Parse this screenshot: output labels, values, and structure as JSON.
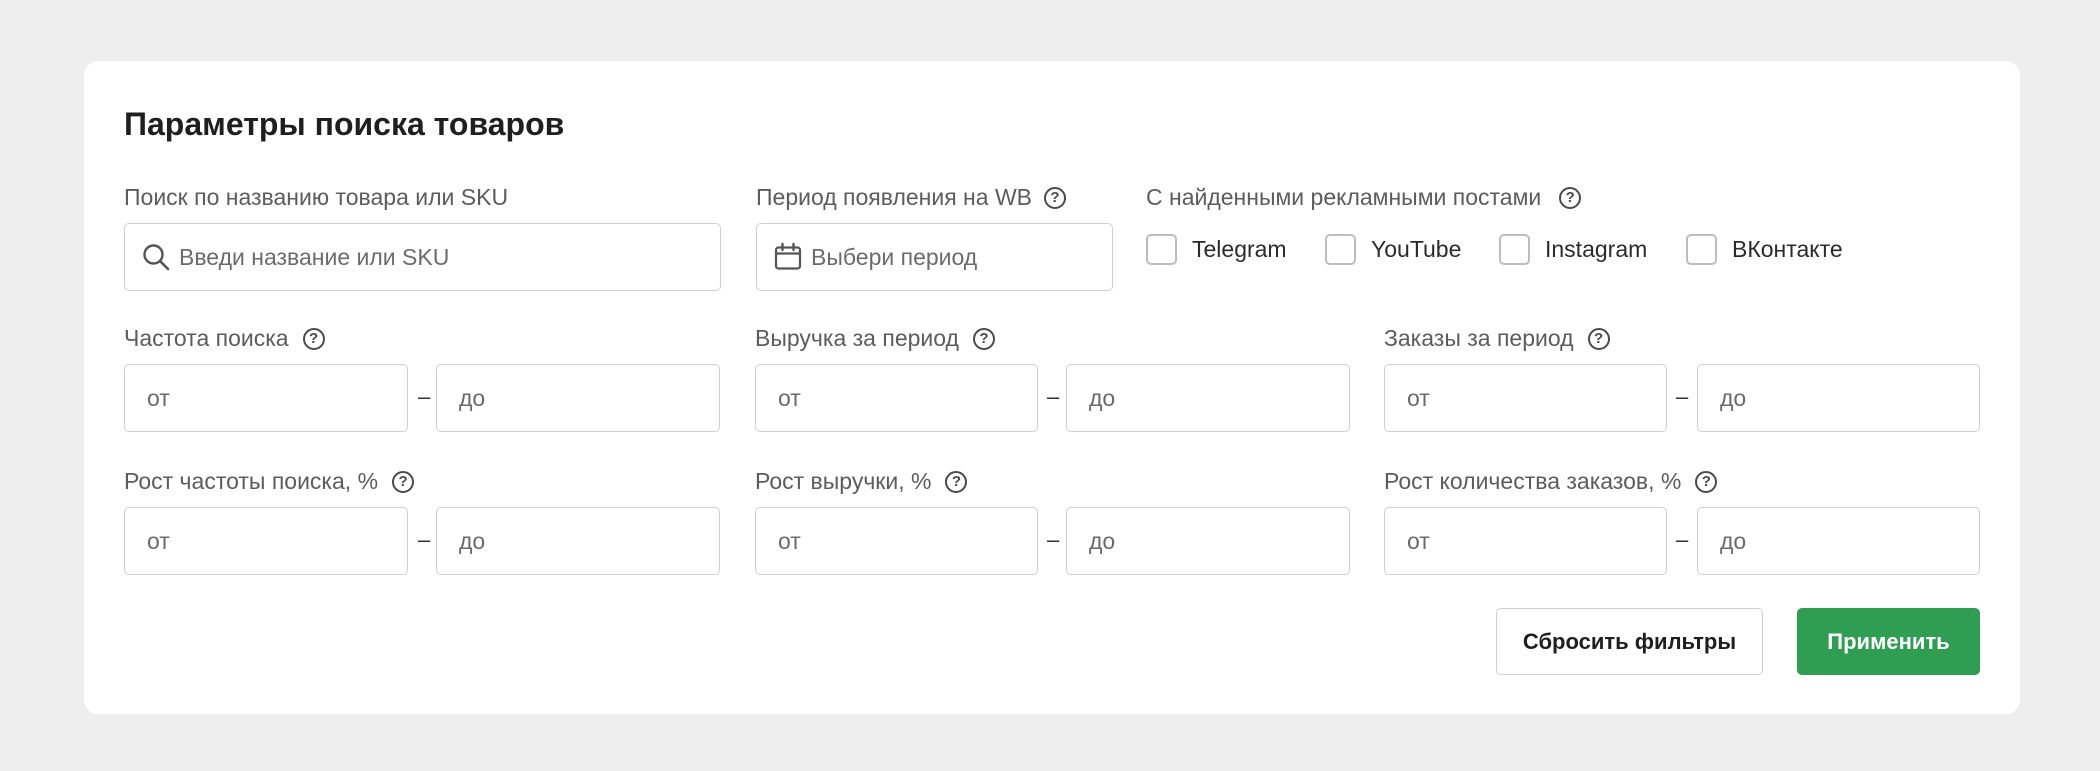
{
  "panel": {
    "title": "Параметры поиска товаров"
  },
  "search": {
    "label": "Поиск по названию товара или SKU",
    "placeholder": "Введи название или SKU",
    "value": ""
  },
  "period": {
    "label": "Период появления на WB",
    "placeholder": "Выбери период"
  },
  "ad_posts": {
    "label": "С найденными рекламными постами",
    "options": [
      {
        "label": "Telegram",
        "checked": false
      },
      {
        "label": "YouTube",
        "checked": false
      },
      {
        "label": "Instagram",
        "checked": false
      },
      {
        "label": "ВКонтакте",
        "checked": false
      }
    ]
  },
  "ranges": [
    {
      "label": "Частота поиска",
      "from_placeholder": "от",
      "to_placeholder": "до"
    },
    {
      "label": "Выручка за период",
      "from_placeholder": "от",
      "to_placeholder": "до"
    },
    {
      "label": "Заказы за период",
      "from_placeholder": "от",
      "to_placeholder": "до"
    },
    {
      "label": "Рост частоты поиска, %",
      "from_placeholder": "от",
      "to_placeholder": "до"
    },
    {
      "label": "Рост выручки, %",
      "from_placeholder": "от",
      "to_placeholder": "до"
    },
    {
      "label": "Рост количества заказов, %",
      "from_placeholder": "от",
      "to_placeholder": "до"
    }
  ],
  "range_separator": "–",
  "help_glyph": "?",
  "buttons": {
    "reset": "Сбросить фильтры",
    "apply": "Применить"
  },
  "colors": {
    "apply_bg": "#2f9e52",
    "background": "#eeeeee",
    "card": "#ffffff"
  },
  "icons": {
    "search": "search-icon",
    "period": "calendar-icon",
    "help": "help-circle-icon"
  }
}
